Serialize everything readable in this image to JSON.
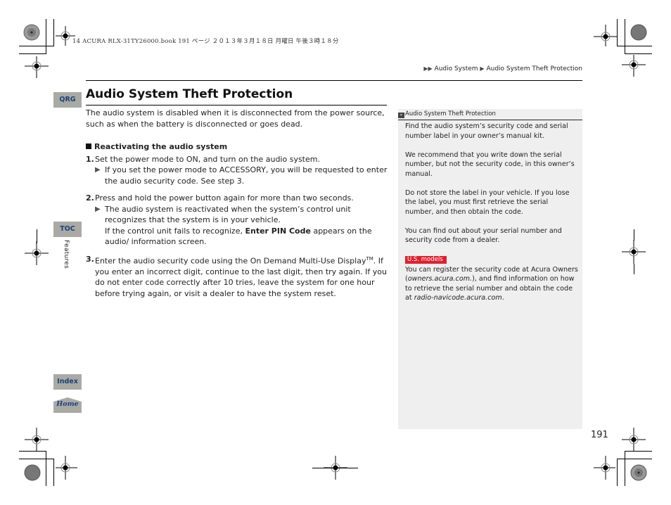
{
  "print_header": {
    "text": "14 ACURA RLX-31TY26000.book  191 ページ  ２０１３年３月１８日  月曜日  午後３時１８分"
  },
  "breadcrumb": {
    "items": [
      "Audio System",
      "Audio System Theft Protection"
    ]
  },
  "nav_tabs": {
    "qrg": "QRG",
    "toc": "TOC",
    "index": "Index",
    "home": "Home",
    "section_label": "Features"
  },
  "page": {
    "title": "Audio System Theft Protection",
    "intro": "The audio system is disabled when it is disconnected from the power source, such as when the battery is disconnected or goes dead.",
    "section_heading": "Reactivating the audio system",
    "steps": [
      {
        "num": "1.",
        "text": "Set the power mode to ON, and turn on the audio system.",
        "notes": [
          "If you set the power mode to ACCESSORY, you will be requested to enter the audio security code. See step 3."
        ]
      },
      {
        "num": "2.",
        "text": "Press and hold the power button again for more than two seconds.",
        "notes": [
          "The audio system is reactivated when the system’s control unit recognizes that the system is in your vehicle."
        ],
        "extra_before": "If the control unit fails to recognize, ",
        "extra_bold": "Enter PIN Code",
        "extra_after": " appears on the audio/ information screen."
      },
      {
        "num": "3.",
        "text_before": "Enter the audio security code using the On Demand Multi-Use Display",
        "text_sup": "TM",
        "text_after": ". If you enter an incorrect digit, continue to the last digit, then try again. If you do not enter code correctly after 10 tries, leave the system for one hour before trying again, or visit a dealer to have the system reset."
      }
    ]
  },
  "sidebar": {
    "heading": "Audio System Theft Protection",
    "paragraphs": [
      "Find the audio system’s security code and serial number label in your owner’s manual kit.",
      "We recommend that you write down the serial number, but not the security code, in this owner’s manual.",
      "Do not store the label in your vehicle. If you lose the label, you must first retrieve the serial number, and then obtain the code.",
      "You can find out about your serial number and security code from a dealer."
    ],
    "badge": "U.S. models",
    "us_text_1": "You can register the security code at Acura Owners (",
    "us_link_1": "owners.acura.com.",
    "us_text_2": "), and find information on how to retrieve the serial number and obtain the code at ",
    "us_link_2": "radio-navicode.acura.com",
    "us_text_3": "."
  },
  "page_number": "191",
  "colors": {
    "nav_tab_bg": "#a9aaa4",
    "nav_tab_text": "#1c3f7a",
    "sidebar_bg": "#efefef",
    "badge_red": "#e0202e"
  }
}
